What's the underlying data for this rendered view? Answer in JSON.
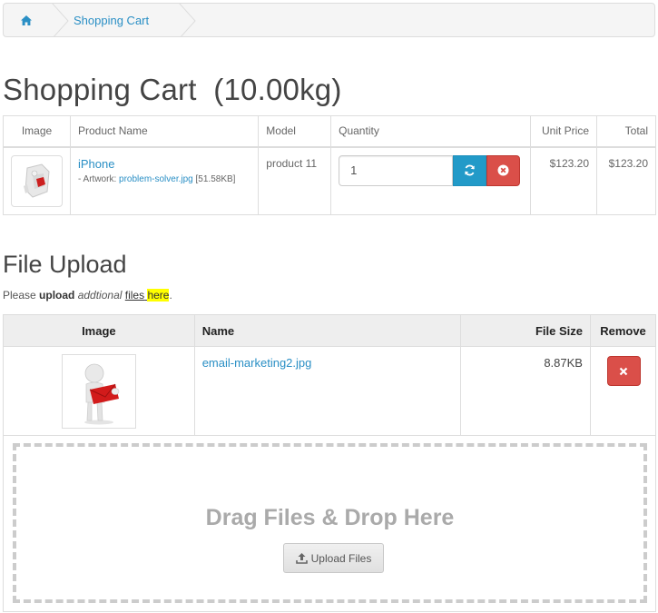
{
  "breadcrumb": {
    "home_icon": "home-icon",
    "current": "Shopping Cart"
  },
  "page_title": "Shopping Cart  (10.00kg)",
  "cart": {
    "headers": {
      "image": "Image",
      "product_name": "Product Name",
      "model": "Model",
      "quantity": "Quantity",
      "unit_price": "Unit Price",
      "total": "Total"
    },
    "items": [
      {
        "name": "iPhone",
        "option_prefix": "- Artwork: ",
        "option_file": "problem-solver.jpg",
        "option_size": " [51.58KB]",
        "model": "product 11",
        "quantity": "1",
        "unit_price": "$123.20",
        "total": "$123.20"
      }
    ],
    "colors": {
      "update": "#229ac8",
      "remove": "#da4f49"
    }
  },
  "upload": {
    "title": "File Upload",
    "note": {
      "please": "Please ",
      "upload": "upload",
      "addtional": "addtional",
      "files": "files",
      "here": "here",
      "period": "."
    },
    "headers": {
      "image": "Image",
      "name": "Name",
      "file_size": "File Size",
      "remove": "Remove"
    },
    "files": [
      {
        "name": "email-marketing2.jpg",
        "size": "8.87KB"
      }
    ],
    "drop_text": "Drag Files & Drop Here",
    "upload_button": "Upload Files"
  }
}
